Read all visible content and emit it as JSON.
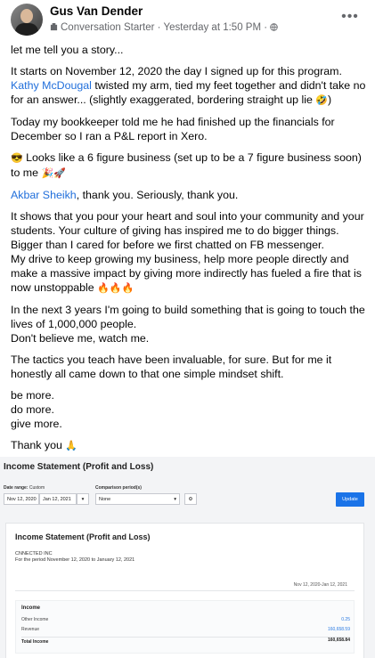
{
  "post": {
    "author": "Gus Van Dender",
    "badge": "Conversation Starter",
    "time": "Yesterday at 1:50 PM",
    "paragraphs": {
      "p1": "let me tell you a story...",
      "p2a": "It starts on November 12, 2020 the day I signed up for this program.",
      "p2_mention": "Kathy McDougal",
      "p2b": " twisted my arm, tied my feet together and didn't take no for an answer... (slightly exaggerated, bordering straight up lie ",
      "p2_emoji": "🤣",
      "p2c": ")",
      "p3": "Today my bookkeeper told me he had finished up the financials for December so I ran a P&L report in Xero.",
      "p4_emoji1": "😎",
      "p4": " Looks like a 6 figure business (set up to be a 7 figure business soon) to me ",
      "p4_emoji2": "🎉🚀",
      "p5_mention": "Akbar Sheikh",
      "p5": ", thank you. Seriously, thank you.",
      "p6": "It shows that you pour your heart and soul into your community and your students. Your culture of giving has inspired me to do bigger things. Bigger than I cared for before we first chatted on FB messenger.",
      "p7": "My drive to keep growing my business, help more people directly and make a massive impact by giving more indirectly has fueled a fire that is now unstoppable ",
      "p7_emoji": "🔥🔥🔥",
      "p8": "In the next 3 years I'm going to build something that is going to touch the lives of 1,000,000 people.",
      "p9": "Don't believe me, watch me.",
      "p10": "The tactics you teach have been invaluable, for sure. But for me it honestly all came down to that one simple mindset shift.",
      "p11a": "be more.",
      "p11b": "do more.",
      "p11c": "give more.",
      "p12": "Thank you ",
      "p12_emoji": "🙏"
    }
  },
  "report": {
    "page_title": "Income Statement (Profit and Loss)",
    "date_range_label": "Date range:",
    "date_range_mode": "Custom",
    "date_from": "Nov 12, 2020",
    "date_to": "Jan 12, 2021",
    "comparison_label": "Comparison period(s)",
    "comparison_value": "None",
    "update_label": "Update",
    "card_title": "Income Statement (Profit and Loss)",
    "company": "CNNECTED INC",
    "period": "For the period November 12, 2020 to January 12, 2021",
    "range": "Nov 12, 2020-Jan 12, 2021",
    "section": "Income",
    "rows": [
      {
        "label": "Other Income",
        "value": "0.25"
      },
      {
        "label": "Revenue",
        "value": "160,658.59"
      },
      {
        "label": "Total Income",
        "value": "160,658.84"
      }
    ]
  }
}
